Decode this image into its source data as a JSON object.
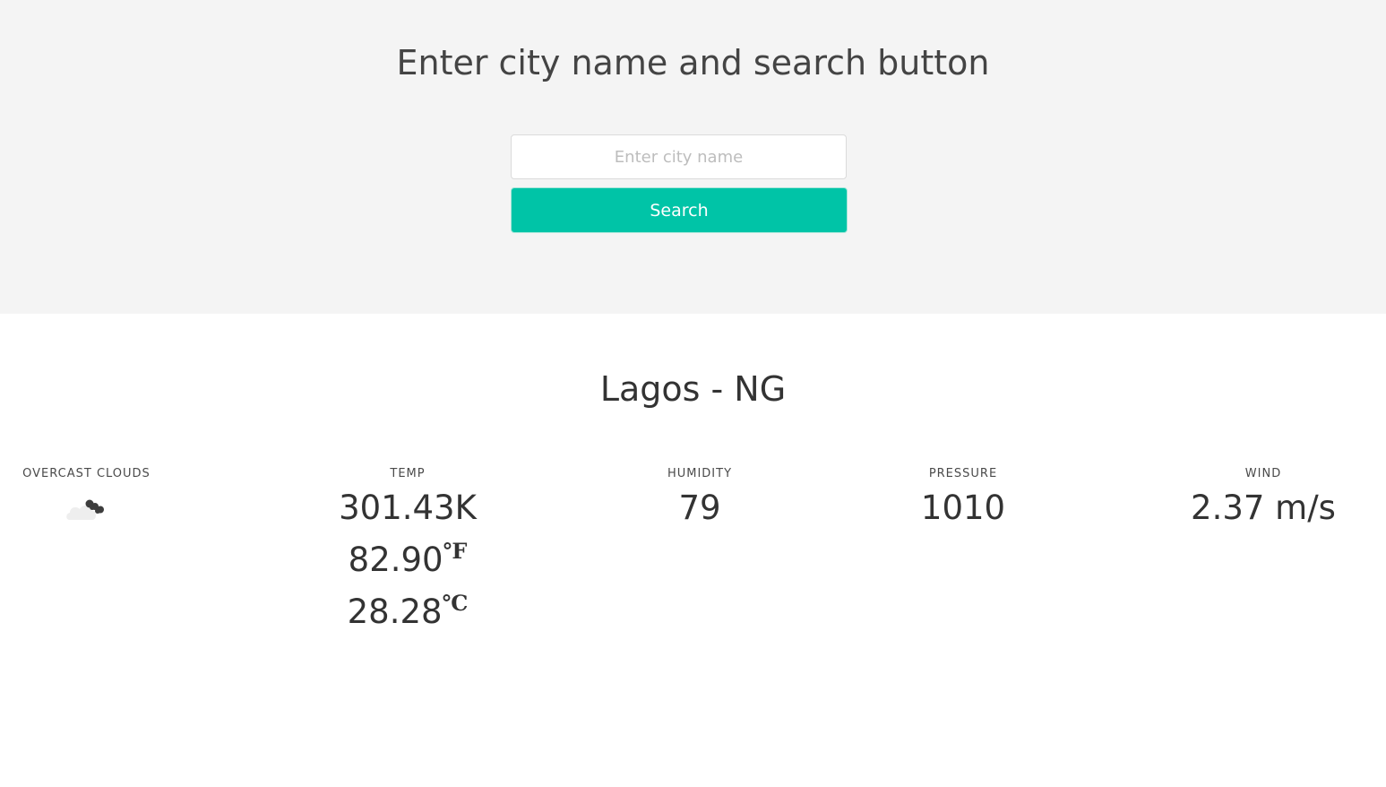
{
  "header": {
    "title": "Enter city name and search button"
  },
  "search": {
    "placeholder": "Enter city name",
    "value": "",
    "button_label": "Search"
  },
  "location": {
    "title": "Lagos - NG"
  },
  "stats": {
    "condition": {
      "label": "OVERCAST CLOUDS",
      "icon": "overcast-clouds-icon"
    },
    "temp": {
      "label": "TEMP",
      "kelvin": "301.43K",
      "fahrenheit": "82.90",
      "fahrenheit_unit": "℉",
      "celsius": "28.28",
      "celsius_unit": "℃"
    },
    "humidity": {
      "label": "HUMIDITY",
      "value": "79"
    },
    "pressure": {
      "label": "PRESSURE",
      "value": "1010"
    },
    "wind": {
      "label": "WIND",
      "value": "2.37 m/s"
    }
  },
  "colors": {
    "accent": "#00c4a7",
    "hero_background": "#f4f4f4"
  }
}
